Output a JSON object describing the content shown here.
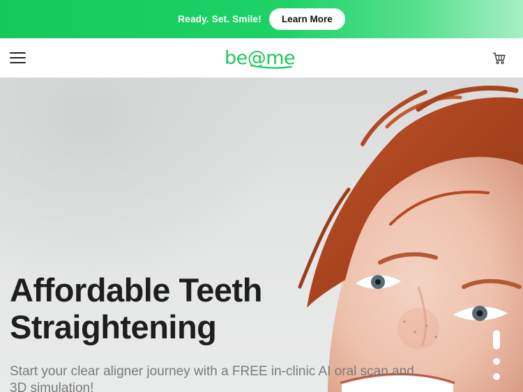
{
  "promo": {
    "text": "Ready. Set. Smile!",
    "button_label": "Learn More"
  },
  "header": {
    "logo_text": "be@me",
    "menu_icon": "hamburger-menu-icon",
    "cart_icon": "shopping-cart-icon"
  },
  "hero": {
    "title_line1": "Affordable Teeth",
    "title_line2": "Straightening",
    "subtitle": "Start your clear aligner journey with a FREE in-clinic AI oral scan and 3D simulation!",
    "slides_total": 3,
    "active_slide": 1
  },
  "colors": {
    "brand_green": "#1ec760",
    "promo_gradient_start": "#14c95a",
    "promo_gradient_end": "#a6efc6",
    "title_text": "#1e1e1e",
    "subtitle_text": "#7a7a7a"
  }
}
